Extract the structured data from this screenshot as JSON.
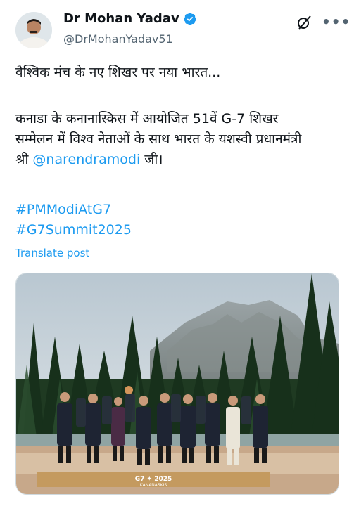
{
  "author": {
    "name": "Dr Mohan Yadav",
    "handle": "@DrMohanYadav51"
  },
  "post": {
    "line1": "वैश्विक मंच के नए शिखर पर नया भारत...",
    "para2_line1": "कनाडा के कनानास्किस में आयोजित 51वें G-7 शिखर",
    "para2_line2": "सम्मेलन में विश्व नेताओं के साथ भारत के यशस्वी प्रधानमंत्री",
    "para2_line3_pre": "श्री ",
    "mention": "@narendramodi",
    "para2_line3_post": " जी।",
    "hashtag1": "#PMModiAtG7",
    "hashtag2": "#G7Summit2025",
    "translate_label": "Translate post"
  },
  "media": {
    "stage_sign": "G7 ✦ 2025",
    "stage_sign_sub": "KANANASKIS"
  },
  "colors": {
    "link": "#1d9bf0",
    "verified": "#1d9bf0",
    "muted": "#536471"
  },
  "icons": [
    "verified-badge-icon",
    "grok-icon",
    "more-options-icon"
  ]
}
